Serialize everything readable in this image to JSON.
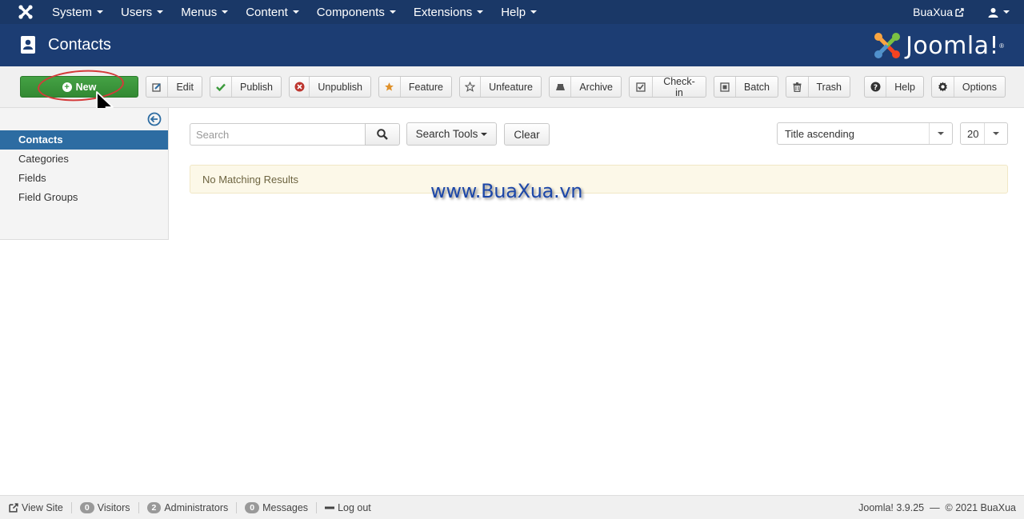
{
  "navbar": {
    "menu": [
      "System",
      "Users",
      "Menus",
      "Content",
      "Components",
      "Extensions",
      "Help"
    ],
    "user_label": "BuaXua"
  },
  "header": {
    "title": "Contacts",
    "brand": "Joomla!"
  },
  "toolbar": {
    "new_label": "New",
    "buttons": [
      {
        "label": "Edit",
        "icon": "edit-icon"
      },
      {
        "label": "Publish",
        "icon": "check-icon"
      },
      {
        "label": "Unpublish",
        "icon": "unpublish-icon"
      },
      {
        "label": "Feature",
        "icon": "star-filled-icon"
      },
      {
        "label": "Unfeature",
        "icon": "star-outline-icon"
      },
      {
        "label": "Archive",
        "icon": "archive-icon"
      },
      {
        "label": "Check-in",
        "icon": "checkbox-icon"
      },
      {
        "label": "Batch",
        "icon": "batch-icon"
      },
      {
        "label": "Trash",
        "icon": "trash-icon"
      },
      {
        "label": "Help",
        "icon": "question-icon"
      },
      {
        "label": "Options",
        "icon": "gear-icon"
      }
    ]
  },
  "sidebar": {
    "items": [
      {
        "label": "Contacts",
        "active": true
      },
      {
        "label": "Categories",
        "active": false
      },
      {
        "label": "Fields",
        "active": false
      },
      {
        "label": "Field Groups",
        "active": false
      }
    ]
  },
  "filters": {
    "search_placeholder": "Search",
    "search_tools_label": "Search Tools",
    "clear_label": "Clear",
    "sort_value": "Title ascending",
    "limit_value": "20"
  },
  "results": {
    "message": "No Matching Results"
  },
  "watermark": "www.BuaXua.vn",
  "status": {
    "view_site": "View Site",
    "visitors_count": "0",
    "visitors_label": "Visitors",
    "admins_count": "2",
    "admins_label": "Administrators",
    "messages_count": "0",
    "messages_label": "Messages",
    "logout": "Log out",
    "version": "Joomla! 3.9.25",
    "copyright": "© 2021 BuaXua"
  },
  "colors": {
    "navbar": "#1a3867",
    "header": "#1c3d73",
    "new_button": "#3c9a3c",
    "sidebar_active": "#2d6ca2"
  }
}
